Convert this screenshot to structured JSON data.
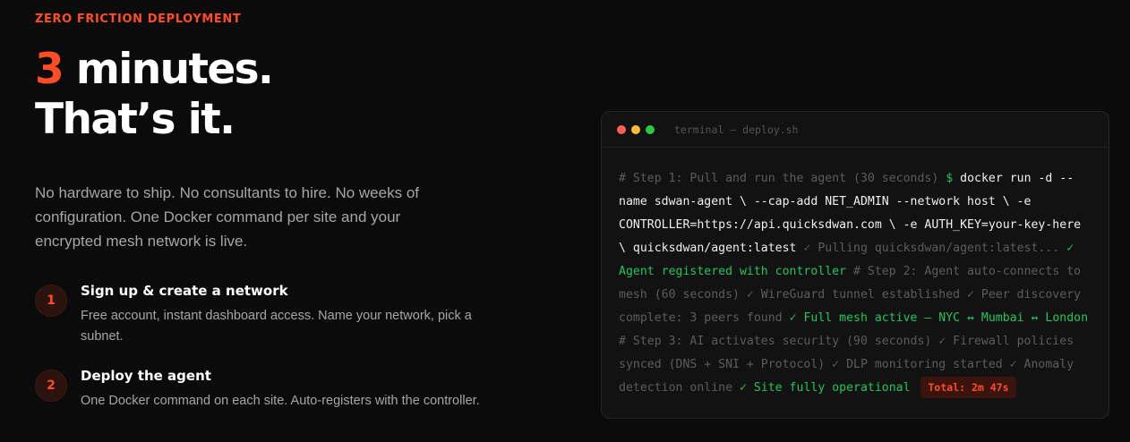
{
  "eyebrow": "ZERO FRICTION DEPLOYMENT",
  "headline": {
    "accent": "3",
    "line1_rest": " minutes.",
    "line2": "That’s it."
  },
  "lede": "No hardware to ship. No consultants to hire. No weeks of configuration. One Docker command per site and your encrypted mesh network is live.",
  "steps": [
    {
      "number": "1",
      "title": "Sign up & create a network",
      "description": "Free account, instant dashboard access. Name your network, pick a subnet."
    },
    {
      "number": "2",
      "title": "Deploy the agent",
      "description": "One Docker command on each site. Auto-registers with the controller."
    }
  ],
  "terminal": {
    "title": "terminal — deploy.sh",
    "window_controls": [
      "close-dot",
      "minimize-dot",
      "maximize-dot"
    ],
    "segments": [
      {
        "style": "c",
        "text": "# Step 1: Pull and run the agent (30 seconds) "
      },
      {
        "style": "p",
        "text": "$ "
      },
      {
        "style": "k",
        "text": "docker run -d --name sdwan-agent \\ --cap-add NET_ADMIN --network host \\ -e CONTROLLER=https://api.quicksdwan.com \\ -e AUTH_KEY=your-key-here \\ quicksdwan/agent:latest "
      },
      {
        "style": "c",
        "text": "✓ Pulling quicksdwan/agent:latest... "
      },
      {
        "style": "g",
        "text": "✓ Agent registered with controller "
      },
      {
        "style": "c",
        "text": "# Step 2: Agent auto-connects to mesh (60 seconds) ✓ WireGuard tunnel established ✓ Peer discovery complete: 3 peers found "
      },
      {
        "style": "g",
        "text": "✓ Full mesh active — NYC ↔ Mumbai ↔ London "
      },
      {
        "style": "c",
        "text": "# Step 3: AI activates security (90 seconds) ✓ Firewall policies synced (DNS + SNI + Protocol) ✓ DLP monitoring started ✓ Anomaly detection online "
      },
      {
        "style": "g",
        "text": "✓ Site fully operational "
      },
      {
        "style": "t",
        "text": "Total: 2m 47s"
      }
    ]
  },
  "colors": {
    "accent": "#ff4d24",
    "success": "#22c55e",
    "background": "#0b0b0b"
  }
}
